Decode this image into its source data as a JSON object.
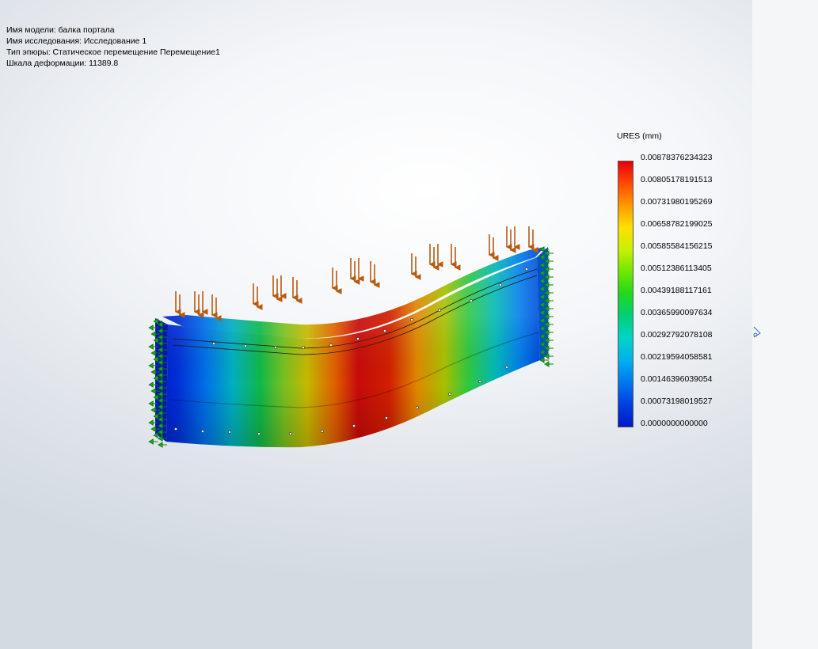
{
  "study_info": {
    "model_name": "Имя модели: балка портала",
    "study_name": "Имя  исследования: Исследование 1",
    "plot_type": "Тип эпюры: Статическое перемещение Перемещение1",
    "deformation_scale": "Шкала деформации: 11389.8"
  },
  "legend": {
    "title": "URES (mm)",
    "values": [
      "0.00878376234323",
      "0.00805178191513",
      "0.00731980195269",
      "0.00658782199025",
      "0.00585584156215",
      "0.00512386113405",
      "0.00439188117161",
      "0.00365990097634",
      "0.00292792078108",
      "0.00219594058581",
      "0.00146396039054",
      "0.00073198019527",
      "0.0000000000000"
    ],
    "colors": [
      "#e8000b",
      "#ff4a00",
      "#ff9a00",
      "#ffe000",
      "#c8f000",
      "#6ee800",
      "#1ed81e",
      "#00d07a",
      "#00d4c8",
      "#00b0f0",
      "#0078f0",
      "#0040e0",
      "#0018c8"
    ]
  }
}
